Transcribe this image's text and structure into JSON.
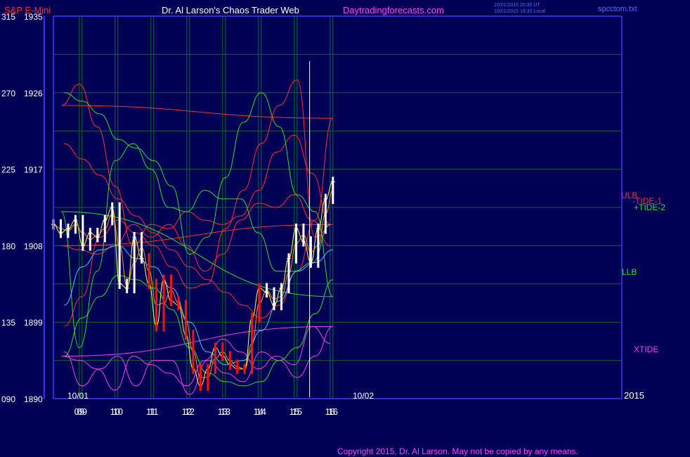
{
  "header": {
    "symbol": "S&P E-Mini",
    "title": "Dr. Al Larson's Chaos Trader Web",
    "site": "Daytradingforecasts.com",
    "stamp1": "10/01/2015 20:30 UT",
    "stamp2": "10/01/2015 16:30 Local",
    "file": "spcctom.txt"
  },
  "footer": {
    "copyright": "Copyright 2015, Dr. Al Larson. May not be copied by any means."
  },
  "colors": {
    "background": "#000055",
    "grid": "#0a6a2a",
    "axis": "#3a3aff",
    "label": "#ffffff",
    "price_bar": "#ffffff",
    "red_bar": "#ff1010",
    "ulb": "#ff3030",
    "llb": "#30dd30",
    "tide": "#ff3030",
    "xtide": "#ee44ee",
    "cyan": "#40c8ff",
    "yellow": "#ffff40",
    "orange": "#ff9020"
  },
  "chart_data": {
    "type": "line",
    "y_left_outer_ticks": [
      "315",
      "270",
      "225",
      "180",
      "135",
      "090"
    ],
    "y_left_inner_ticks": [
      "1935",
      "1926",
      "1917",
      "1908",
      "1899",
      "1890"
    ],
    "ylim": [
      1890,
      1935
    ],
    "x_ticks": [
      "09",
      "10",
      "11",
      "12",
      "13",
      "14",
      "15",
      "16",
      "09",
      "10",
      "11",
      "12",
      "13",
      "14",
      "15",
      "16"
    ],
    "date_labels": [
      "10/01",
      "10/02"
    ],
    "year_label": "2015",
    "series_labels": {
      "ulb": "ULB",
      "tide1": "-TIDE-1",
      "tide2": "+TIDE-2",
      "llb": "LLB",
      "xtide": "XTIDE"
    },
    "x_hours": [
      8.5,
      9,
      9.5,
      10,
      10.5,
      11,
      11.5,
      12,
      12.5,
      13,
      13.5,
      14,
      14.5,
      15,
      15.5,
      16,
      16.5,
      17,
      17.5,
      18,
      18.5,
      19,
      19.5,
      20,
      20.5,
      21,
      21.5,
      22,
      22.5,
      23,
      23.5,
      24
    ],
    "series": {
      "ulb": [
        1920,
        1918.2,
        1916.3,
        1913.5,
        1911.5,
        1909.5,
        1907.5,
        1905.5,
        1904,
        1902.5,
        1901,
        1899.5,
        1901,
        1905,
        1911,
        1923,
        1924.5,
        1927,
        1922,
        1915,
        1908,
        1910.5,
        1910,
        1912,
        1911,
        1910.5,
        1911.5,
        1914.5,
        1919,
        1921,
        1916.5,
        1910.5
      ],
      "tide": [
        1898.5,
        1902,
        1909,
        1911,
        1909.5,
        1908,
        1905.5,
        1903,
        1903.5,
        1910,
        1914.5,
        1920,
        1924.5,
        1927.5,
        1909,
        1910.5,
        1908,
        1907.5,
        1907,
        1908,
        1910.5,
        1909,
        1910.5,
        1908,
        1905,
        1907,
        1911,
        1913,
        1912.5,
        1914,
        1911,
        1908
      ],
      "llb": [
        1926,
        1925,
        1923.5,
        1920.5,
        1919.5,
        1918,
        1915,
        1907,
        1909,
        1916,
        1922.5,
        1926,
        1922,
        1914,
        1912,
        1902,
        1912,
        1896,
        1905,
        1918,
        1920,
        1917,
        1912.5,
        1912,
        1914.5,
        1913.5,
        1913.5,
        1909.5,
        1905,
        1905,
        1906,
        1910.5
      ],
      "band_green": [
        1895,
        1899.5,
        1902,
        1904.5,
        1904,
        1903,
        1900.5,
        1896,
        1893,
        1892,
        1891.5,
        1892,
        1894.5,
        1896,
        1900,
        1904
      ],
      "cyan": [
        1901,
        1905.5,
        1907.5,
        1908,
        1906.5,
        1905.5,
        1903,
        1899,
        1895.5,
        1894,
        1894.5,
        1898,
        1901.5,
        1905,
        1906,
        1907.5
      ],
      "xtide": [
        1895.5,
        1891.5,
        1893.5,
        1895,
        1891.5,
        1894.5,
        1894.5,
        1890.5,
        1894.5,
        1893,
        1892,
        1895.5,
        1894.5,
        1892.5,
        1895,
        1898.5,
        1895,
        1894.5,
        1893.5,
        1891,
        1895,
        1894,
        1893,
        1891.5,
        1894.5,
        1897,
        1895.5,
        1893.5,
        1895,
        1894,
        1898.5,
        1896.5
      ]
    },
    "price_closes": [
      1910.5,
      1909.5,
      1910,
      1911,
      1908,
      1909.5,
      1909,
      1911,
      1912.5,
      1903.5,
      1903,
      1909,
      1906.5,
      1903.5,
      1898.5,
      1904,
      1901.5,
      1901,
      1897.5,
      1893.5,
      1891.5,
      1893.5,
      1896,
      1895,
      1894,
      1893.5,
      1893.5,
      1899.5,
      1903,
      1902.5,
      1901,
      1903,
      1906.5,
      1910,
      1908.5,
      1906,
      1910,
      1913.5,
      1915.5
    ],
    "red_segment": [
      13,
      28
    ]
  }
}
